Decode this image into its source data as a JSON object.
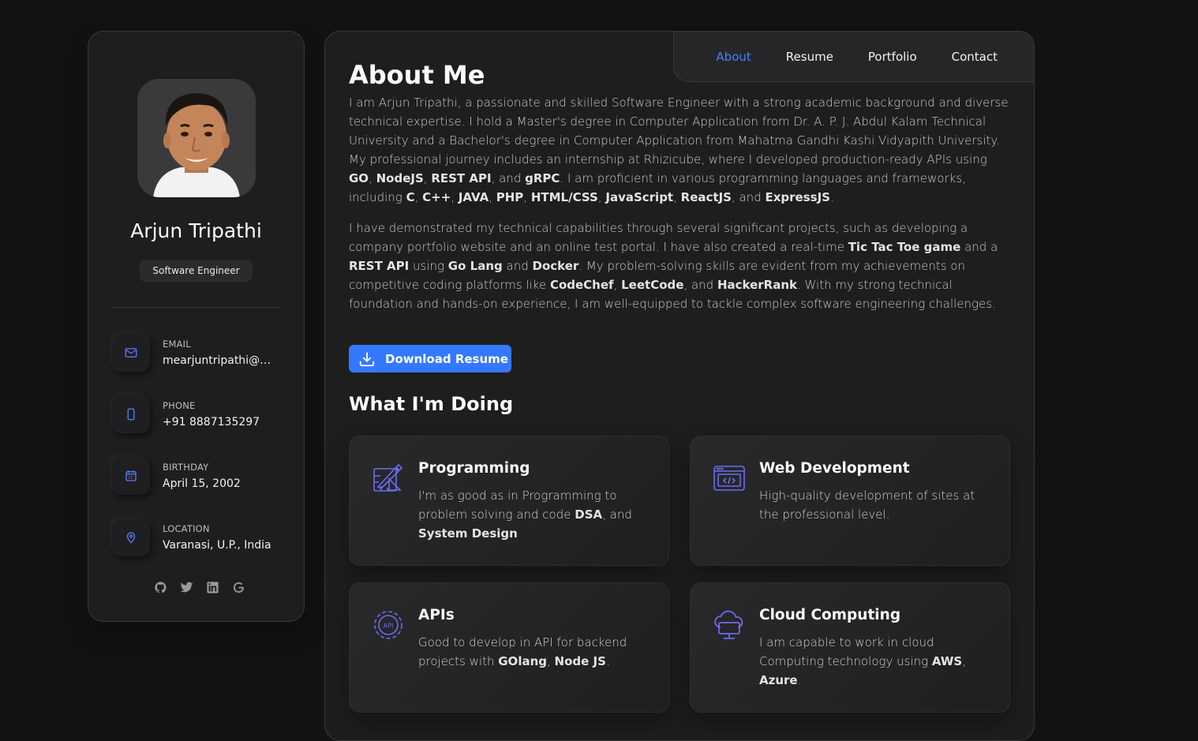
{
  "profile": {
    "name": "Arjun Tripathi",
    "role": "Software Engineer"
  },
  "contacts": [
    {
      "label": "EMAIL",
      "value": "mearjuntripathi@g...",
      "icon": "mail-icon"
    },
    {
      "label": "PHONE",
      "value": "+91 8887135297",
      "icon": "phone-icon"
    },
    {
      "label": "BIRTHDAY",
      "value": "April 15, 2002",
      "icon": "calendar-icon"
    },
    {
      "label": "LOCATION",
      "value": "Varanasi, U.P., India",
      "icon": "location-pin-icon"
    }
  ],
  "social": [
    "github-icon",
    "twitter-icon",
    "linkedin-icon",
    "google-icon"
  ],
  "nav": {
    "about": "About",
    "resume": "Resume",
    "portfolio": "Portfolio",
    "contact": "Contact",
    "active": "About"
  },
  "about": {
    "title": "About Me",
    "p1": [
      {
        "t": "I am Arjun Tripathi, a passionate and skilled Software Engineer with a strong academic background and diverse technical expertise. I hold a Master's degree in Computer Application from Dr. A. P. J. Abdul Kalam Technical University and a Bachelor's degree in Computer Application from Mahatma Gandhi Kashi Vidyapith University. My professional journey includes an internship at Rhizicube, where I developed production-ready APIs using "
      },
      {
        "t": "GO",
        "b": true
      },
      {
        "t": ", "
      },
      {
        "t": "NodeJS",
        "b": true
      },
      {
        "t": ", "
      },
      {
        "t": "REST API",
        "b": true
      },
      {
        "t": ", and "
      },
      {
        "t": "gRPC",
        "b": true
      },
      {
        "t": ". I am proficient in various programming languages and frameworks, including "
      },
      {
        "t": "C",
        "b": true
      },
      {
        "t": ", "
      },
      {
        "t": "C++",
        "b": true
      },
      {
        "t": ", "
      },
      {
        "t": "JAVA",
        "b": true
      },
      {
        "t": ", "
      },
      {
        "t": "PHP",
        "b": true
      },
      {
        "t": ", "
      },
      {
        "t": "HTML/CSS",
        "b": true
      },
      {
        "t": ", "
      },
      {
        "t": "JavaScript",
        "b": true
      },
      {
        "t": ", "
      },
      {
        "t": "ReactJS",
        "b": true
      },
      {
        "t": ", and "
      },
      {
        "t": "ExpressJS",
        "b": true
      },
      {
        "t": "."
      }
    ],
    "p2": [
      {
        "t": "I have demonstrated my technical capabilities through several significant projects, such as developing a company portfolio website and an online test portal. I have also created a real-time "
      },
      {
        "t": "Tic Tac Toe game",
        "b": true
      },
      {
        "t": " and a "
      },
      {
        "t": "REST API",
        "b": true
      },
      {
        "t": " using "
      },
      {
        "t": "Go Lang",
        "b": true
      },
      {
        "t": " and "
      },
      {
        "t": "Docker",
        "b": true
      },
      {
        "t": ". My problem-solving skills are evident from my achievements on competitive coding platforms like "
      },
      {
        "t": "CodeChef",
        "b": true
      },
      {
        "t": ", "
      },
      {
        "t": "LeetCode",
        "b": true
      },
      {
        "t": ", and "
      },
      {
        "t": "HackerRank",
        "b": true
      },
      {
        "t": ". With my strong technical foundation and hands-on experience, I am well-equipped to tackle complex software engineering challenges."
      }
    ]
  },
  "download_label": "Download Resume",
  "doing": {
    "title": "What I'm Doing",
    "services": [
      {
        "title": "Programming",
        "icon": "programming-icon",
        "text": [
          {
            "t": "I'm as good as in Programming to problem solving and code "
          },
          {
            "t": "DSA",
            "b": true
          },
          {
            "t": ", and "
          },
          {
            "t": "System Design",
            "b": true
          }
        ]
      },
      {
        "title": "Web Development",
        "icon": "web-development-icon",
        "text": [
          {
            "t": "High-quality development of sites at the professional level."
          }
        ]
      },
      {
        "title": "APIs",
        "icon": "api-gear-icon",
        "text": [
          {
            "t": "Good to develop in API for backend projects with "
          },
          {
            "t": "GOlang",
            "b": true
          },
          {
            "t": ", "
          },
          {
            "t": "Node JS",
            "b": true
          },
          {
            "t": "."
          }
        ]
      },
      {
        "title": "Cloud Computing",
        "icon": "cloud-computing-icon",
        "text": [
          {
            "t": "I am capable to work in cloud Computing technology using "
          },
          {
            "t": "AWS",
            "b": true
          },
          {
            "t": ", "
          },
          {
            "t": "Azure",
            "b": true
          },
          {
            "t": "."
          }
        ]
      }
    ]
  },
  "colors": {
    "accent": "#3478ff",
    "icon_purple": "#6b6cf0",
    "background": "#121212",
    "card": "#1e1e1f"
  }
}
